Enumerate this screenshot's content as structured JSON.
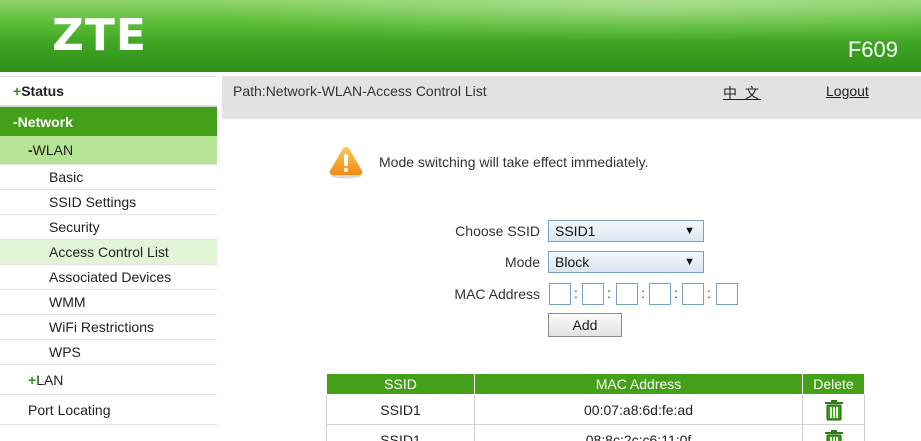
{
  "header": {
    "logo": "ZTE",
    "model": "F609"
  },
  "sidebar": {
    "items": [
      {
        "sym": "+",
        "label": "Status",
        "level": 1
      },
      {
        "sym": "-",
        "label": "Network",
        "level": 1
      },
      {
        "sym": "-",
        "label": "WLAN",
        "level": 2
      },
      {
        "label": "Basic",
        "level": 3
      },
      {
        "label": "SSID Settings",
        "level": 3
      },
      {
        "label": "Security",
        "level": 3
      },
      {
        "label": "Access Control List",
        "level": 3
      },
      {
        "label": "Associated Devices",
        "level": 3
      },
      {
        "label": "WMM",
        "level": 3
      },
      {
        "label": "WiFi Restrictions",
        "level": 3
      },
      {
        "label": "WPS",
        "level": 3
      },
      {
        "sym": "+",
        "label": "LAN",
        "level": 2
      },
      {
        "label": "Port Locating",
        "level": 2
      }
    ]
  },
  "pathbar": {
    "path": "Path:Network-WLAN-Access Control List",
    "lang": "中 文",
    "logout": "Logout"
  },
  "notice": {
    "text": "Mode switching will take effect immediately."
  },
  "form": {
    "ssid_label": "Choose SSID",
    "ssid_value": "SSID1",
    "mode_label": "Mode",
    "mode_value": "Block",
    "mac_label": "MAC Address",
    "mac_sep": ":",
    "add_label": "Add"
  },
  "table": {
    "headers": [
      "SSID",
      "MAC Address",
      "Delete"
    ],
    "rows": [
      {
        "ssid": "SSID1",
        "mac": "00:07:a8:6d:fe:ad"
      },
      {
        "ssid": "SSID1",
        "mac": "08:8c:2c:c6:11:0f"
      }
    ]
  },
  "colors": {
    "brand_green": "#45a019",
    "wlan_highlight": "#b4e494",
    "selected_item": "#e2f5d6",
    "warning_orange": "#f5a623"
  }
}
